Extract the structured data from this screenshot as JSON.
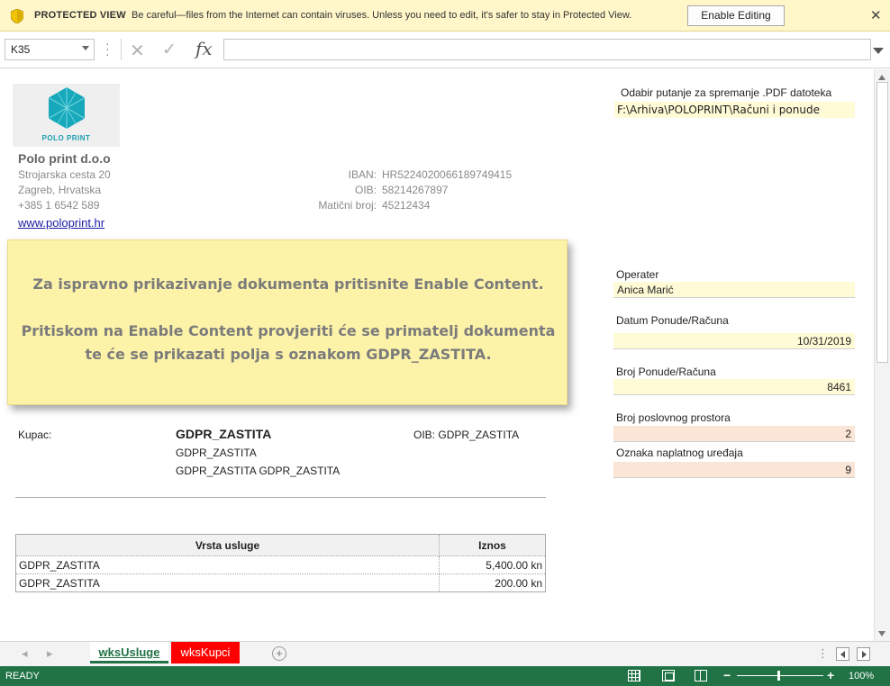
{
  "protected_view": {
    "title": "PROTECTED VIEW",
    "message": "Be careful—files from the Internet can contain viruses. Unless you need to edit, it's safer to stay in Protected View.",
    "enable_button": "Enable Editing"
  },
  "formula_bar": {
    "name_box": "K35",
    "formula": ""
  },
  "company": {
    "logo_text": "POLO PRINT",
    "name": "Polo print d.o.o",
    "street": "Strojarska cesta 20",
    "city": "Zagreb, Hrvatska",
    "phone": "+385 1 6542 589",
    "website": "www.poloprint.hr"
  },
  "bank": {
    "iban_label": "IBAN:",
    "iban": "HR5224020066189749415",
    "oib_label": "OIB:",
    "oib": "58214267897",
    "maticni_label": "Matični broj:",
    "maticni": "45212434"
  },
  "pdf_path": {
    "label": "Odabir putanje za spremanje .PDF datoteka",
    "value": "F:\\Arhiva\\POLOPRINT\\Računi i ponude"
  },
  "fields": {
    "operater_label": "Operater",
    "operater_value": "Anica Marić",
    "datum_label": "Datum Ponude/Računa",
    "datum_value": "10/31/2019",
    "broj_label": "Broj Ponude/Računa",
    "broj_value": "8461",
    "prostor_label": "Broj poslovnog prostora",
    "prostor_value": "2",
    "uredaj_label": "Oznaka naplatnog uređaja",
    "uredaj_value": "9"
  },
  "notice": {
    "line1": "Za ispravno prikazivanje dokumenta pritisnite Enable Content.",
    "line2": "Pritiskom na Enable Content provjeriti će se primatelj dokumenta",
    "line3": "te će se prikazati polja s oznakom GDPR_ZASTITA."
  },
  "customer": {
    "label": "Kupac:",
    "name": "GDPR_ZASTITA",
    "line2": "GDPR_ZASTITA",
    "line3": "GDPR_ZASTITA GDPR_ZASTITA",
    "oib_label": "OIB:",
    "oib": "GDPR_ZASTITA"
  },
  "services_table": {
    "headers": [
      "Vrsta usluge",
      "Iznos"
    ],
    "rows": [
      [
        "GDPR_ZASTITA",
        "5,400.00 kn"
      ],
      [
        "GDPR_ZASTITA",
        "200.00 kn"
      ]
    ]
  },
  "sheet_tabs": {
    "active": "wksUsluge",
    "second": "wksKupci",
    "second_color": "#ff0000"
  },
  "status": {
    "ready": "READY",
    "zoom": "100%",
    "accent": "#217346"
  }
}
